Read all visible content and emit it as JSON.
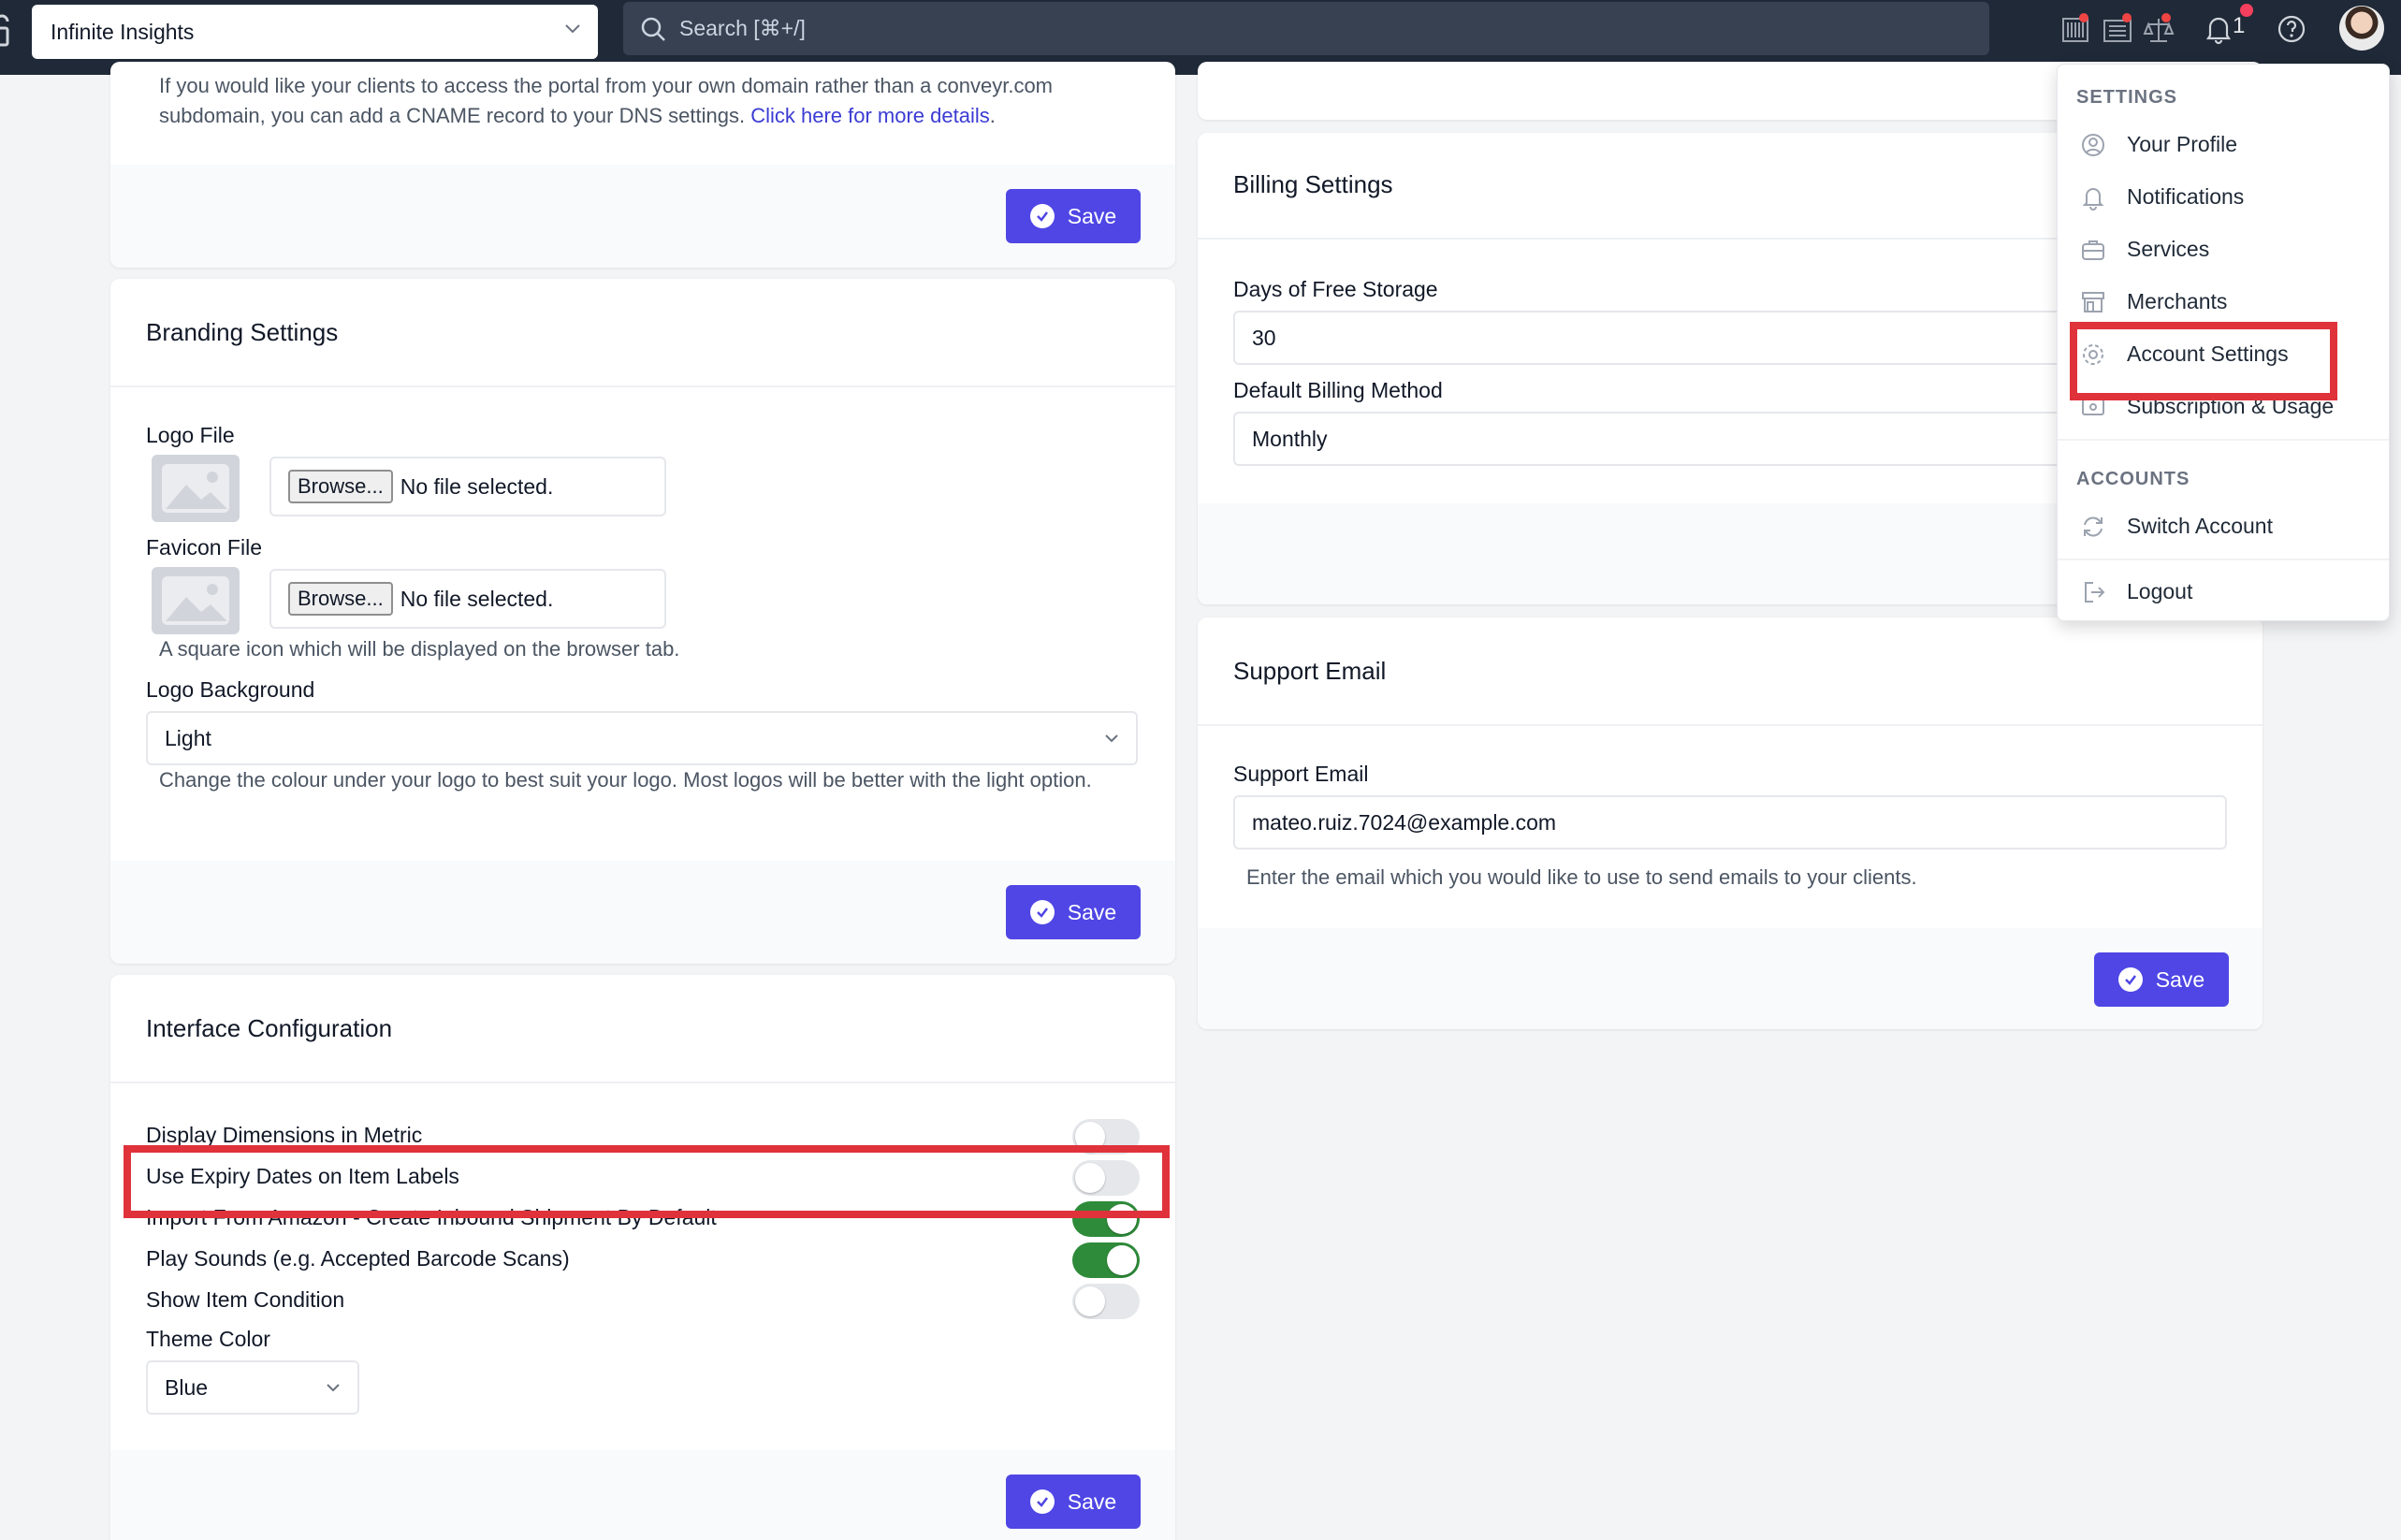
{
  "topbar": {
    "workspace": "Infinite Insights",
    "search_placeholder": "Search [⌘+/]",
    "notification_count": "1"
  },
  "domain_card": {
    "help_text": "If you would like your clients to access the portal from your own domain rather than a conveyr.com subdomain, you can add a CNAME record to your DNS settings.",
    "link_text": "Click here for more details",
    "save_label": "Save"
  },
  "branding": {
    "title": "Branding Settings",
    "logo_label": "Logo File",
    "favicon_label": "Favicon File",
    "browse_label": "Browse...",
    "no_file_text": "No file selected.",
    "favicon_help": "A square icon which will be displayed on the browser tab.",
    "background_label": "Logo Background",
    "background_value": "Light",
    "background_help": "Change the colour under your logo to best suit your logo. Most logos will be better with the light option.",
    "save_label": "Save"
  },
  "interface": {
    "title": "Interface Configuration",
    "toggles": [
      {
        "label": "Display Dimensions in Metric",
        "on": false
      },
      {
        "label": "Use Expiry Dates on Item Labels",
        "on": false
      },
      {
        "label": "Import From Amazon - Create Inbound Shipment By Default",
        "on": true
      },
      {
        "label": "Play Sounds (e.g. Accepted Barcode Scans)",
        "on": true
      },
      {
        "label": "Show Item Condition",
        "on": false
      }
    ],
    "theme_label": "Theme Color",
    "theme_value": "Blue",
    "save_label": "Save"
  },
  "billing": {
    "title": "Billing Settings",
    "storage_label": "Days of Free Storage",
    "storage_value": "30",
    "method_label": "Default Billing Method",
    "method_value": "Monthly"
  },
  "support": {
    "title": "Support Email",
    "email_label": "Support Email",
    "email_value": "mateo.ruiz.7024@example.com",
    "email_help": "Enter the email which you would like to use to send emails to your clients.",
    "save_label": "Save"
  },
  "menu": {
    "settings_heading": "SETTINGS",
    "settings_items": [
      {
        "label": "Your Profile",
        "icon": "user-circle-icon"
      },
      {
        "label": "Notifications",
        "icon": "bell-icon"
      },
      {
        "label": "Services",
        "icon": "briefcase-icon"
      },
      {
        "label": "Merchants",
        "icon": "storefront-icon"
      },
      {
        "label": "Account Settings",
        "icon": "gear-icon"
      },
      {
        "label": "Subscription & Usage",
        "icon": "cash-icon"
      }
    ],
    "accounts_heading": "ACCOUNTS",
    "switch_label": "Switch Account",
    "logout_label": "Logout"
  },
  "colors": {
    "topbar_bg": "#1f2937",
    "accent": "#4f46e5",
    "toggle_on": "#2e8b3a",
    "highlight": "#e0323b"
  }
}
